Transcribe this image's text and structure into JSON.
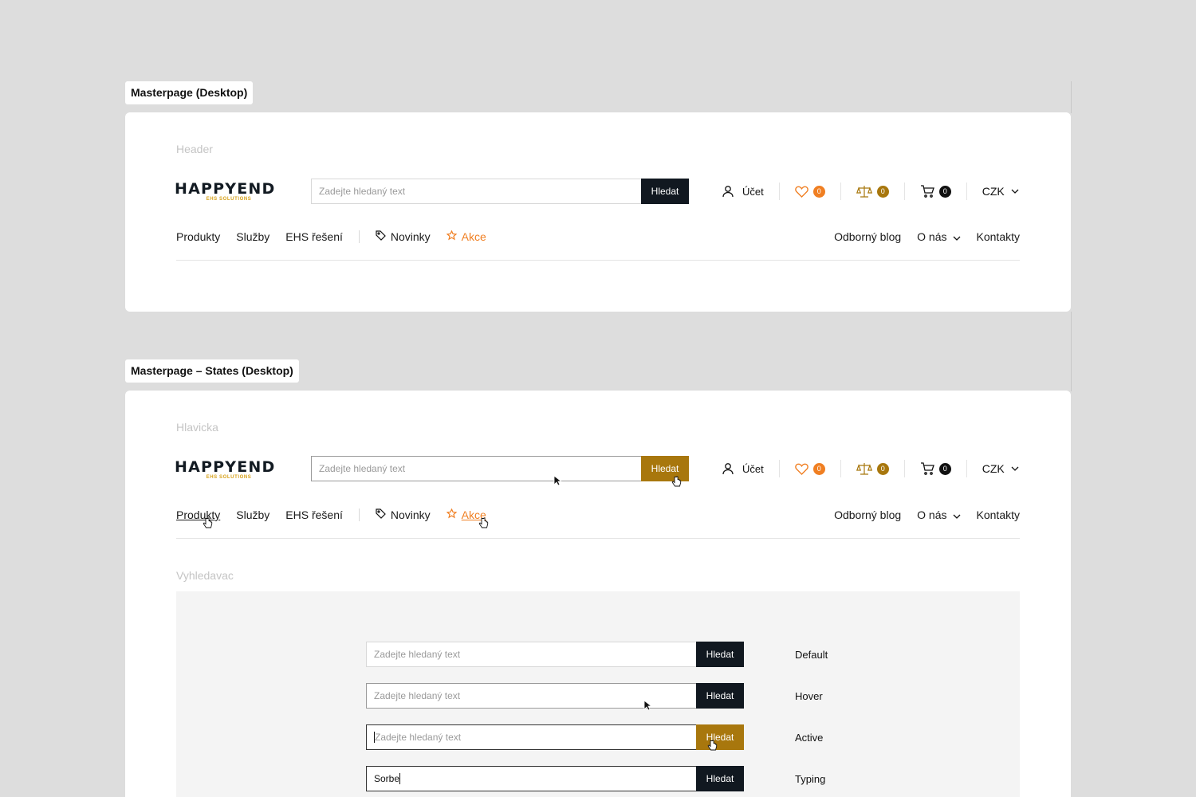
{
  "frames": {
    "desktop_title": "Masterpage (Desktop)",
    "states_title": "Masterpage – States (Desktop)"
  },
  "sections": {
    "header": "Header",
    "hlavicka": "Hlavicka",
    "vyhledavac": "Vyhledavac"
  },
  "logo": {
    "word": "HAPPYEND",
    "sub": "EHS SOLUTIONS"
  },
  "search": {
    "placeholder": "Zadejte hledaný text",
    "button": "Hledat",
    "typed_value": "Sorbe"
  },
  "util": {
    "account": "Účet",
    "wishlist_count": "0",
    "compare_count": "0",
    "cart_count": "0",
    "currency": "CZK"
  },
  "nav": {
    "products": "Produkty",
    "services": "Služby",
    "ehs": "EHS řešení",
    "news": "Novinky",
    "promo": "Akce",
    "blog": "Odborný blog",
    "about": "O nás",
    "contacts": "Kontakty"
  },
  "states": {
    "default": "Default",
    "hover": "Hover",
    "active": "Active",
    "typing": "Typing"
  },
  "colors": {
    "dark": "#111820",
    "gold": "#a8770d",
    "orange": "#f07f22",
    "logo_accent": "#d7a21a"
  }
}
